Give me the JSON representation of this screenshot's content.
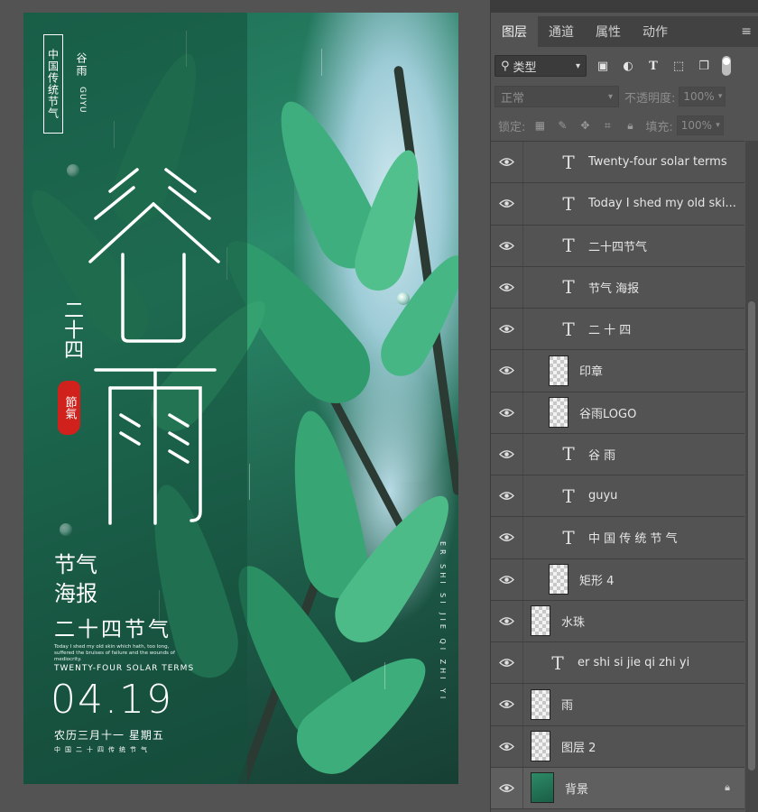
{
  "poster": {
    "tag": "中国传统节气",
    "title_small": "谷雨",
    "title_latin": "GUYU",
    "logo_alt": "谷雨",
    "ershisi": "二十四",
    "seal": "節氣",
    "jieqi_haibao_line1": "节气",
    "jieqi_haibao_line2": "海报",
    "ershisi_jieqi": "二十四节气",
    "english_para": "Today I shed my old skin which hath, too long, suffered the bruises of failure and the wounds of mediocrity.",
    "solar_terms": "TWENTY-FOUR SOLAR TERMS",
    "date": "04.19",
    "lunar": "农历三月十一 星期五",
    "bottom_small": "中国二十四传统节气",
    "pinyin_vertical": "ER SHI SI JIE QI ZHI YI"
  },
  "panel": {
    "tabs": [
      {
        "label": "图层",
        "active": true
      },
      {
        "label": "通道",
        "active": false
      },
      {
        "label": "属性",
        "active": false
      },
      {
        "label": "动作",
        "active": false
      }
    ],
    "filter": {
      "label": "类型"
    },
    "blend_mode": "正常",
    "opacity_label": "不透明度:",
    "opacity_value": "100%",
    "lock_label": "锁定:",
    "fill_label": "填充:",
    "fill_value": "100%",
    "layers": [
      {
        "name": "Twenty-four solar terms",
        "kind": "text",
        "indent": 2
      },
      {
        "name": "Today I shed my old ski...",
        "kind": "text",
        "indent": 2
      },
      {
        "name": "二十四节气",
        "kind": "text",
        "indent": 2
      },
      {
        "name": "节气 海报",
        "kind": "text",
        "indent": 2
      },
      {
        "name": "二 十 四",
        "kind": "text",
        "indent": 2
      },
      {
        "name": "印章",
        "kind": "image",
        "indent": 1
      },
      {
        "name": "谷雨LOGO",
        "kind": "image",
        "indent": 1
      },
      {
        "name": "谷 雨",
        "kind": "text",
        "indent": 2
      },
      {
        "name": "guyu",
        "kind": "text",
        "indent": 2
      },
      {
        "name": "中 国 传 统 节 气",
        "kind": "text",
        "indent": 2
      },
      {
        "name": "矩形 4",
        "kind": "image",
        "indent": 1
      },
      {
        "name": "水珠",
        "kind": "image",
        "indent": 0
      },
      {
        "name": "er shi si jie qi zhi yi",
        "kind": "text",
        "indent": 1
      },
      {
        "name": "雨",
        "kind": "image",
        "indent": 0
      },
      {
        "name": "图层 2",
        "kind": "image",
        "indent": 0
      },
      {
        "name": "背景",
        "kind": "image",
        "indent": 0,
        "locked": true,
        "selected": true
      }
    ]
  },
  "colors": {
    "panel_bg": "#535353",
    "seal_red": "#d0211c",
    "poster_green": "#1f6e55"
  }
}
